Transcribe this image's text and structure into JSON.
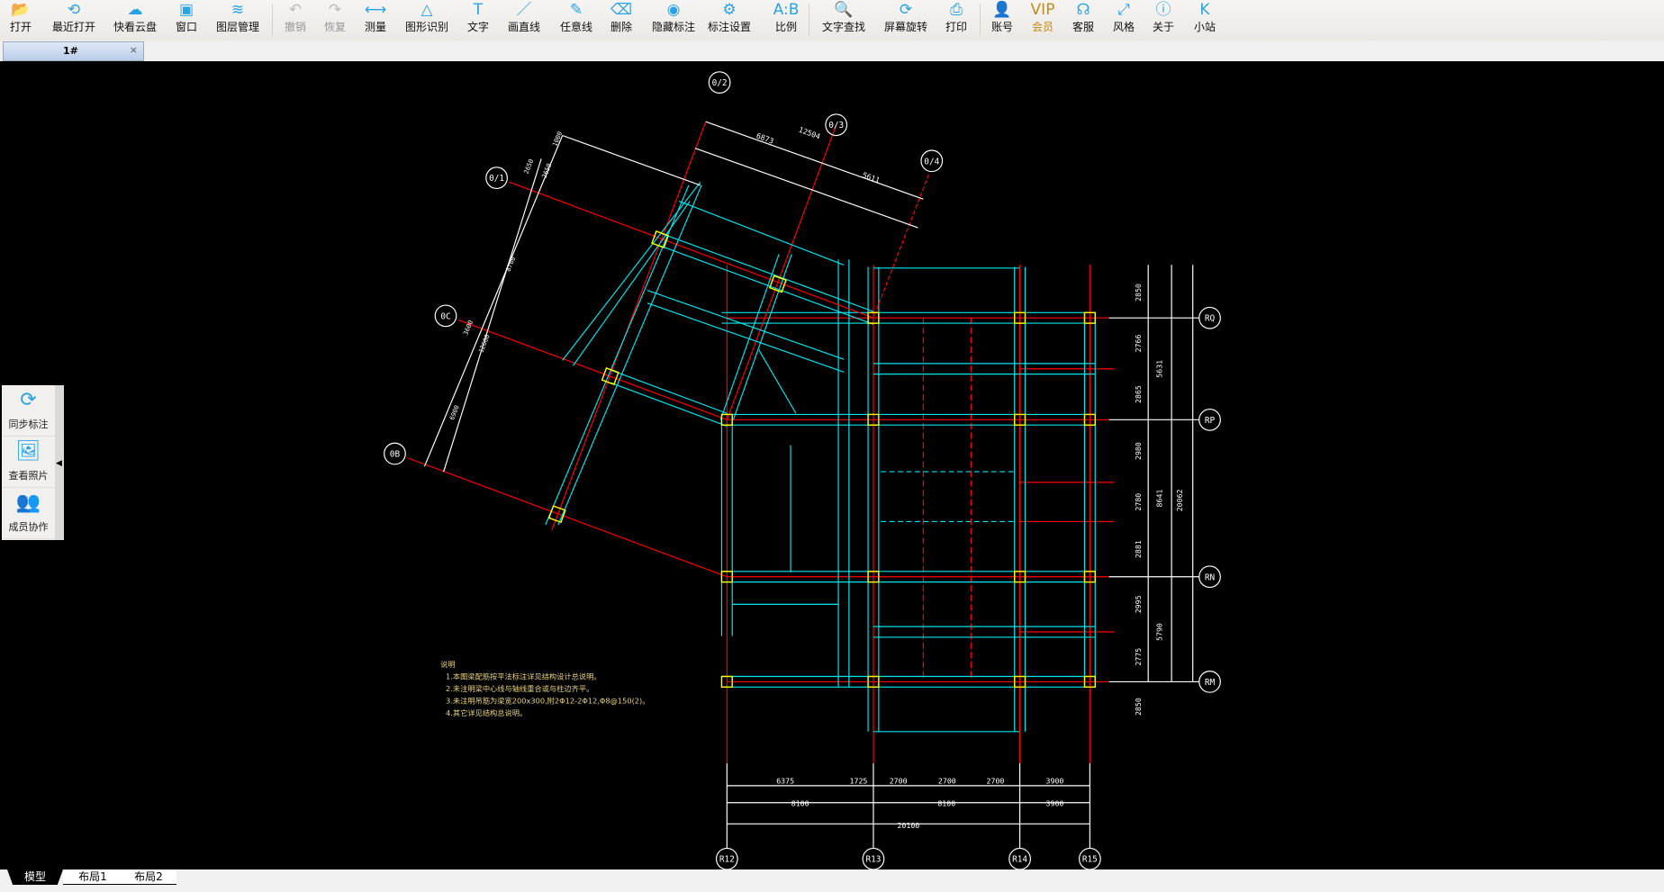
{
  "toolbar": {
    "items": [
      {
        "label": "打开",
        "icon": "folder-icon",
        "glyph": "📂",
        "state": "normal"
      },
      {
        "label": "最近打开",
        "icon": "recent-icon",
        "glyph": "⟲",
        "state": "normal"
      },
      {
        "label": "快看云盘",
        "icon": "cloud-icon",
        "glyph": "☁",
        "state": "normal"
      },
      {
        "label": "窗口",
        "icon": "window-icon",
        "glyph": "▣",
        "state": "normal"
      },
      {
        "label": "图层管理",
        "icon": "layers-icon",
        "glyph": "≋",
        "state": "normal"
      },
      {
        "label": "撤销",
        "icon": "undo-icon",
        "glyph": "↶",
        "state": "disabled"
      },
      {
        "label": "恢复",
        "icon": "redo-icon",
        "glyph": "↷",
        "state": "disabled"
      },
      {
        "label": "测量",
        "icon": "measure-icon",
        "glyph": "⟷",
        "state": "normal"
      },
      {
        "label": "图形识别",
        "icon": "shape-recognize-icon",
        "glyph": "△",
        "state": "normal"
      },
      {
        "label": "文字",
        "icon": "text-icon",
        "glyph": "T",
        "state": "normal"
      },
      {
        "label": "画直线",
        "icon": "line-icon",
        "glyph": "／",
        "state": "normal"
      },
      {
        "label": "任意线",
        "icon": "pen-icon",
        "glyph": "✎",
        "state": "normal"
      },
      {
        "label": "删除",
        "icon": "eraser-icon",
        "glyph": "⌫",
        "state": "normal"
      },
      {
        "label": "隐藏标注",
        "icon": "hide-eye-icon",
        "glyph": "◉",
        "state": "normal"
      },
      {
        "label": "标注设置",
        "icon": "annotation-settings-icon",
        "glyph": "⚙",
        "state": "normal"
      },
      {
        "label": "比例",
        "icon": "scale-icon",
        "glyph": "A:B",
        "state": "normal"
      },
      {
        "label": "文字查找",
        "icon": "text-search-icon",
        "glyph": "🔍",
        "state": "normal"
      },
      {
        "label": "屏幕旋转",
        "icon": "rotate-screen-icon",
        "glyph": "⟳",
        "state": "normal"
      },
      {
        "label": "打印",
        "icon": "print-icon",
        "glyph": "⎙",
        "state": "normal"
      },
      {
        "label": "账号",
        "icon": "account-icon",
        "glyph": "👤",
        "state": "normal"
      },
      {
        "label": "会员",
        "icon": "vip-icon",
        "glyph": "VIP",
        "state": "vip"
      },
      {
        "label": "客服",
        "icon": "headset-icon",
        "glyph": "☊",
        "state": "normal"
      },
      {
        "label": "风格",
        "icon": "style-icon",
        "glyph": "⤢",
        "state": "normal"
      },
      {
        "label": "关于",
        "icon": "info-icon",
        "glyph": "ⓘ",
        "state": "normal"
      },
      {
        "label": "小站",
        "icon": "site-k-icon",
        "glyph": "K",
        "state": "normal"
      }
    ]
  },
  "document_tab": {
    "title": "1#",
    "close": "×"
  },
  "side_panel": [
    {
      "label": "同步标注",
      "icon": "sync-icon",
      "glyph": "⟳"
    },
    {
      "label": "查看照片",
      "icon": "photo-search-icon",
      "glyph": "🖼"
    },
    {
      "label": "成员协作",
      "icon": "members-icon",
      "glyph": "👥"
    }
  ],
  "layout_tabs": [
    "模型",
    "布局1",
    "布局2"
  ],
  "drawing": {
    "axis_bottom": [
      "R12",
      "R13",
      "R14",
      "R15"
    ],
    "axis_right": [
      "RQ",
      "RP",
      "RN",
      "RM"
    ],
    "axis_skew_top": [
      "0/2",
      "0/3",
      "0/4"
    ],
    "axis_skew_left": [
      "0/1",
      "0C",
      "0B"
    ],
    "dims_bottom_row1": [
      "6375",
      "1725",
      "2700",
      "2700",
      "2700",
      "3900"
    ],
    "dims_bottom_row2": [
      "8100",
      "8100",
      "3900"
    ],
    "dims_bottom_total": "20100",
    "dims_right_row1": [
      "2850",
      "2766",
      "2865",
      "2980",
      "2780",
      "2881",
      "2995",
      "2775",
      "2850"
    ],
    "dims_right_row2": [
      "5631",
      "8641",
      "5790"
    ],
    "dims_right_total": "20062",
    "dims_skew_top": [
      "6873",
      "12504",
      "5611"
    ],
    "dims_skew_left": [
      "1000",
      "2650",
      "2650",
      "8700",
      "3600",
      "12600",
      "6900"
    ],
    "notes": [
      "说明",
      "1.本图梁配筋按平法标注详见结构设计总说明。",
      "2.未注明梁中心线与轴线重合或与柱边齐平。",
      "3.未注明吊筋为梁宽200x300,附2Φ12-2Φ12,Φ8@150(2)。",
      "4.其它详见结构总说明。"
    ],
    "colors": {
      "axis": "#ff0000",
      "beam": "#00e5ee",
      "column": "#ffff00",
      "text": "#ffffff",
      "note": "#e8d27a"
    }
  }
}
